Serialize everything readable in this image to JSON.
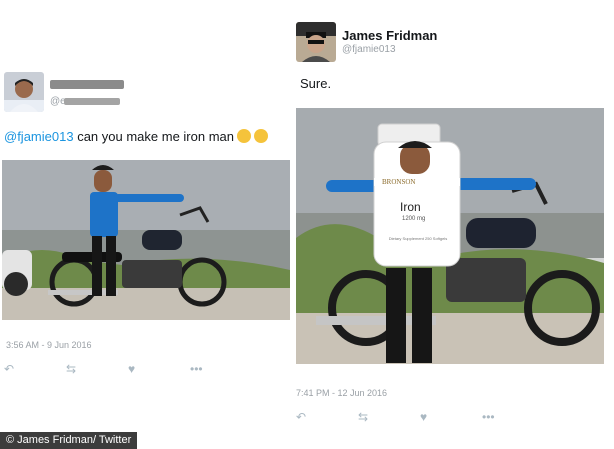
{
  "left_tweet": {
    "handle_partial": "@e",
    "text_mention": "@fjamie013",
    "text_body": " can you make  me iron man",
    "timestamp": "3:56 AM - 9 Jun 2016"
  },
  "right_tweet": {
    "name": "James Fridman",
    "handle": "@fjamie013",
    "text": "Sure.",
    "timestamp": "7:41 PM - 12 Jun 2016",
    "bottle": {
      "brand": "BRONSON",
      "label": "Iron",
      "dose": "1200 mg",
      "subtext": "Dietary Supplement 250 Softgels"
    }
  },
  "actions": [
    {
      "icon": "reply-icon",
      "glyph": "↶"
    },
    {
      "icon": "retweet-icon",
      "glyph": "⇆"
    },
    {
      "icon": "like-icon",
      "glyph": "♥"
    },
    {
      "icon": "more-icon",
      "glyph": "•••"
    }
  ],
  "watermark": "© James Fridman/ Twitter"
}
